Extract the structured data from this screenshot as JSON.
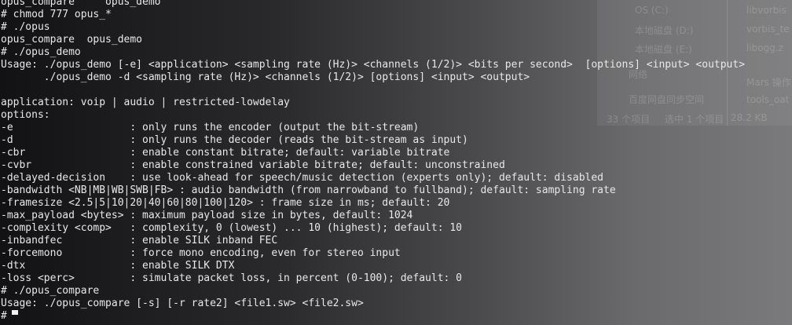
{
  "terminal": {
    "lines": [
      "opus_compare     opus_demo",
      "# chmod 777 opus_*",
      "# ./opus",
      "opus_compare  opus_demo",
      "# ./opus_demo",
      "Usage: ./opus_demo [-e] <application> <sampling rate (Hz)> <channels (1/2)> <bits per second>  [options] <input> <output>",
      "       ./opus_demo -d <sampling rate (Hz)> <channels (1/2)> [options] <input> <output>",
      "",
      "application: voip | audio | restricted-lowdelay",
      "options:",
      "-e                   : only runs the encoder (output the bit-stream)",
      "-d                   : only runs the decoder (reads the bit-stream as input)",
      "-cbr                 : enable constant bitrate; default: variable bitrate",
      "-cvbr                : enable constrained variable bitrate; default: unconstrained",
      "-delayed-decision    : use look-ahead for speech/music detection (experts only); default: disabled",
      "-bandwidth <NB|MB|WB|SWB|FB> : audio bandwidth (from narrowband to fullband); default: sampling rate",
      "-framesize <2.5|5|10|20|40|60|80|100|120> : frame size in ms; default: 20",
      "-max_payload <bytes> : maximum payload size in bytes, default: 1024",
      "-complexity <comp>   : complexity, 0 (lowest) ... 10 (highest); default: 10",
      "-inbandfec           : enable SILK inband FEC",
      "-forcemono           : force mono encoding, even for stereo input",
      "-dtx                 : enable SILK DTX",
      "-loss <perc>         : simulate packet loss, in percent (0-100); default: 0",
      "# ./opus_compare",
      "Usage: ./opus_compare [-s] [-r rate2] <file1.sw> <file2.sw>",
      "# "
    ]
  },
  "background": {
    "items": [
      "OS (C:)",
      "本地磁盘 (D:)",
      "本地磁盘 (E:)",
      "网络",
      "百度网盘同步空间",
      "33 个项目",
      "选中 1 个项目",
      "28.2 KB",
      "libvorbis",
      "vorbis_te",
      "libogg.z",
      "Mars 操作",
      "tools_oat"
    ]
  },
  "colors": {
    "text": "#e8e8e8",
    "background": "#1c1c1e"
  }
}
